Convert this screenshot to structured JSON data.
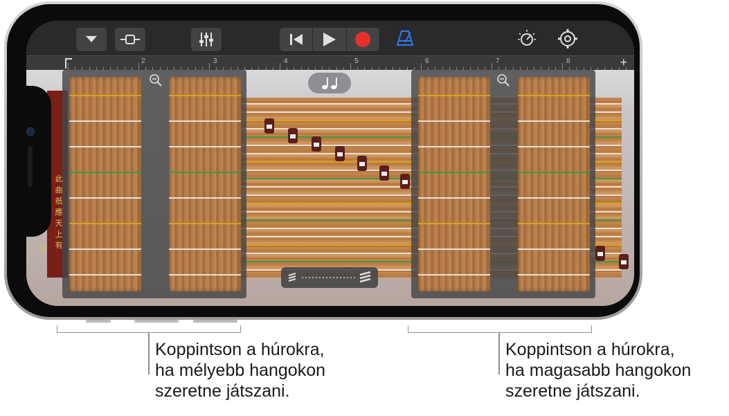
{
  "toolbar": {
    "ruler_numbers": [
      "2",
      "3",
      "4",
      "5",
      "6",
      "7",
      "8"
    ],
    "add_symbol": "+"
  },
  "instrument": {
    "name": "Guzheng",
    "characters": [
      "此",
      "曲",
      "祇",
      "應",
      "天",
      "上",
      "有"
    ],
    "characters_left": [
      "閑"
    ],
    "notes_button_icon": "notes-icon"
  },
  "callouts": {
    "left": "Koppintson a húrokra,\nha mélyebb hangokon\nszeretne játszani.",
    "right": "Koppintson a húrokra,\nha magasabb hangokon\nszeretne játszani."
  },
  "colors": {
    "record": "#e8302a",
    "metronome": "#2f7cf6",
    "string_green": "#3a9a4a",
    "string_yellow": "#d4a51c"
  }
}
